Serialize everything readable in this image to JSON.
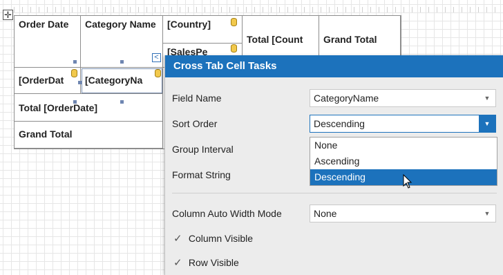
{
  "crosstab": {
    "order_date": "Order Date",
    "category_name": "Category Name",
    "country": "[Country]",
    "sales_person": "[SalesPe",
    "total_count": "Total [Count",
    "grand_total_header": "Grand Total",
    "order_date_field": "[OrderDat",
    "category_name_field": "[CategoryNa",
    "total_order_date": "Total [OrderDate]",
    "grand_total_row": "Grand Total"
  },
  "smart_tag": {
    "glyph": "<"
  },
  "panel": {
    "title": "Cross Tab Cell Tasks",
    "field_name_label": "Field Name",
    "field_name_value": "CategoryName",
    "sort_order_label": "Sort Order",
    "sort_order_value": "Descending",
    "group_interval_label": "Group Interval",
    "format_string_label": "Format String",
    "column_auto_width_label": "Column Auto Width Mode",
    "column_auto_width_value": "None",
    "column_visible_label": "Column Visible",
    "row_visible_label": "Row Visible",
    "column_visible_checked": true,
    "row_visible_checked": true
  },
  "sort_options": [
    "None",
    "Ascending",
    "Descending"
  ],
  "sort_selected_index": 2,
  "icons": {
    "move": "move-handle-icon",
    "database": "database-icon",
    "check": "checkmark-icon",
    "arrow": "dropdown-arrow-icon"
  },
  "colors": {
    "accent": "#1c72bc",
    "grid": "#e6e6e6"
  }
}
